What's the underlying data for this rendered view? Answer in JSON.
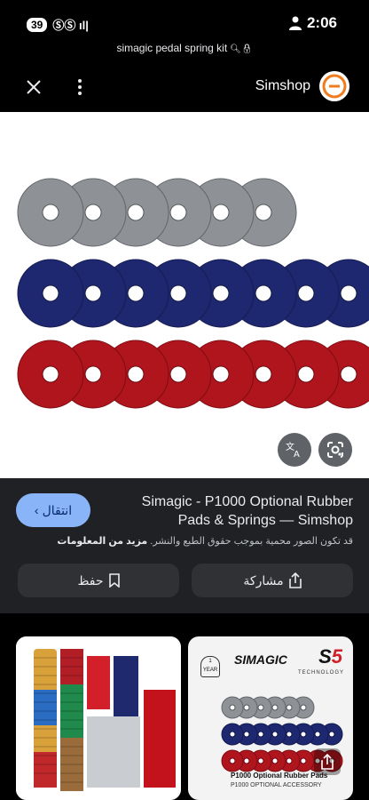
{
  "status_bar": {
    "badge": "39",
    "carrier": "ⓈⓈ ıl|",
    "time": "2:06"
  },
  "url_bar": {
    "text": "simagic pedal spring kit"
  },
  "toolbar": {
    "close_icon": "close-icon",
    "more_icon": "more-vert-icon",
    "site_name": "Simshop"
  },
  "image": {
    "washer_rows": [
      {
        "color": "#8e9296",
        "count": 6
      },
      {
        "color": "#1e2870",
        "count": 8
      },
      {
        "color": "#b0141c",
        "count": 8
      }
    ],
    "translate_icon": "translate-icon",
    "lens_icon": "lens-icon"
  },
  "result": {
    "visit_label": "انتقال",
    "title": "Simagic - P1000 Optional Rubber Pads & Springs — Simshop",
    "copyright": "قد تكون الصور محمية بموجب حقوق الطبع والنشر.",
    "learn_more": "مزيد من المعلومات",
    "save_label": "حفظ",
    "share_label": "مشاركة"
  },
  "related": {
    "brand": "SIMAGIC",
    "model": "S",
    "model_num": "5",
    "tech": "TECHNOLOGY",
    "badge": "1 YEAR",
    "caption1": "P1000 Optional Rubber Pads",
    "caption2": "P1000 OPTIONAL ACCESSORY"
  }
}
